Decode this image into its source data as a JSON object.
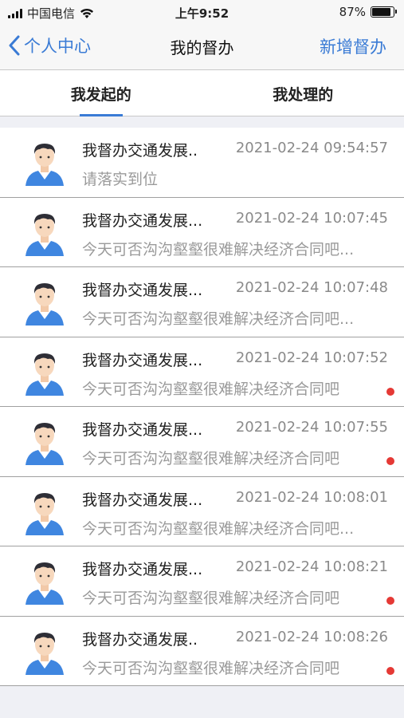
{
  "status_bar": {
    "carrier": "中国电信",
    "time": "上午9:52",
    "battery_percent": "87%",
    "battery_level": 0.87
  },
  "nav": {
    "back_label": "个人中心",
    "title": "我的督办",
    "action_label": "新增督办"
  },
  "tabs": [
    {
      "label": "我发起的",
      "active": true
    },
    {
      "label": "我处理的",
      "active": false
    }
  ],
  "items": [
    {
      "title": "我督办交通发展..",
      "time": "2021-02-24 09:54:57",
      "preview": "请落实到位",
      "unread": false
    },
    {
      "title": "我督办交通发展...",
      "time": "2021-02-24 10:07:45",
      "preview": "今天可否沟沟壑壑很难解决经济合同吧...",
      "unread": false
    },
    {
      "title": "我督办交通发展...",
      "time": "2021-02-24 10:07:48",
      "preview": "今天可否沟沟壑壑很难解决经济合同吧...",
      "unread": false
    },
    {
      "title": "我督办交通发展...",
      "time": "2021-02-24 10:07:52",
      "preview": "今天可否沟沟壑壑很难解决经济合同吧",
      "unread": true
    },
    {
      "title": "我督办交通发展...",
      "time": "2021-02-24 10:07:55",
      "preview": "今天可否沟沟壑壑很难解决经济合同吧",
      "unread": true
    },
    {
      "title": "我督办交通发展...",
      "time": "2021-02-24 10:08:01",
      "preview": "今天可否沟沟壑壑很难解决经济合同吧...",
      "unread": false
    },
    {
      "title": "我督办交通发展...",
      "time": "2021-02-24 10:08:21",
      "preview": "今天可否沟沟壑壑很难解决经济合同吧",
      "unread": true
    },
    {
      "title": "我督办交通发展..",
      "time": "2021-02-24 10:08:26",
      "preview": "今天可否沟沟壑壑很难解决经济合同吧",
      "unread": true
    }
  ],
  "colors": {
    "accent": "#3a7bd5",
    "unread_dot": "#e53935"
  }
}
